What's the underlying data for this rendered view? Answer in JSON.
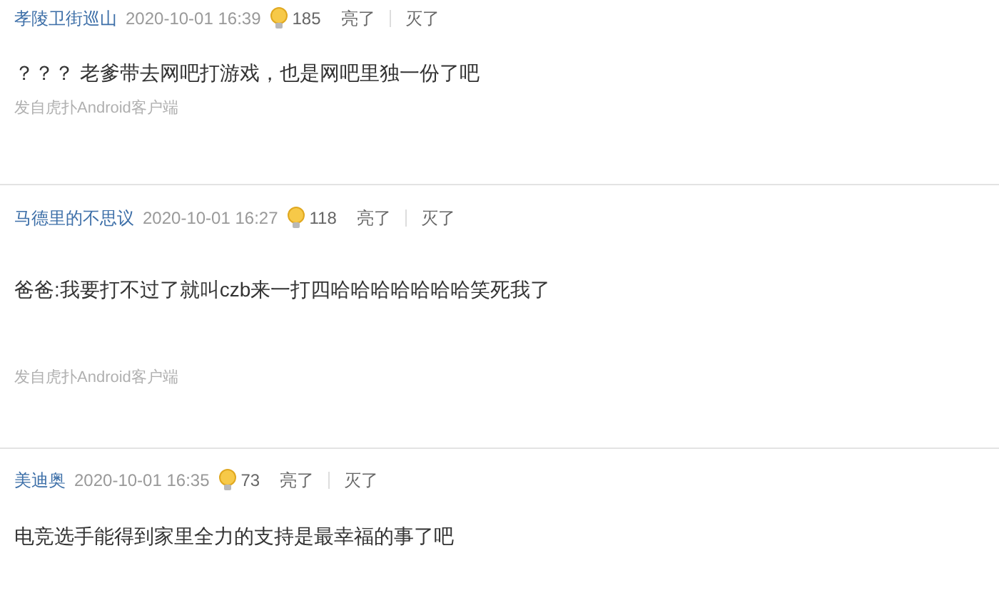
{
  "comments": [
    {
      "user": "孝陵卫街巡山",
      "time": "2020-10-01 16:39",
      "lights": "185",
      "light_label": "亮了",
      "dark_label": "灭了",
      "text": "？？？ 老爹带去网吧打游戏，也是网吧里独一份了吧",
      "source": "发自虎扑Android客户端"
    },
    {
      "user": "马德里的不思议",
      "time": "2020-10-01 16:27",
      "lights": "118",
      "light_label": "亮了",
      "dark_label": "灭了",
      "text": "爸爸:我要打不过了就叫czb来一打四哈哈哈哈哈哈哈笑死我了",
      "source": "发自虎扑Android客户端"
    },
    {
      "user": "美迪奥",
      "time": "2020-10-01 16:35",
      "lights": "73",
      "light_label": "亮了",
      "dark_label": "灭了",
      "text": "电竞选手能得到家里全力的支持是最幸福的事了吧"
    }
  ]
}
